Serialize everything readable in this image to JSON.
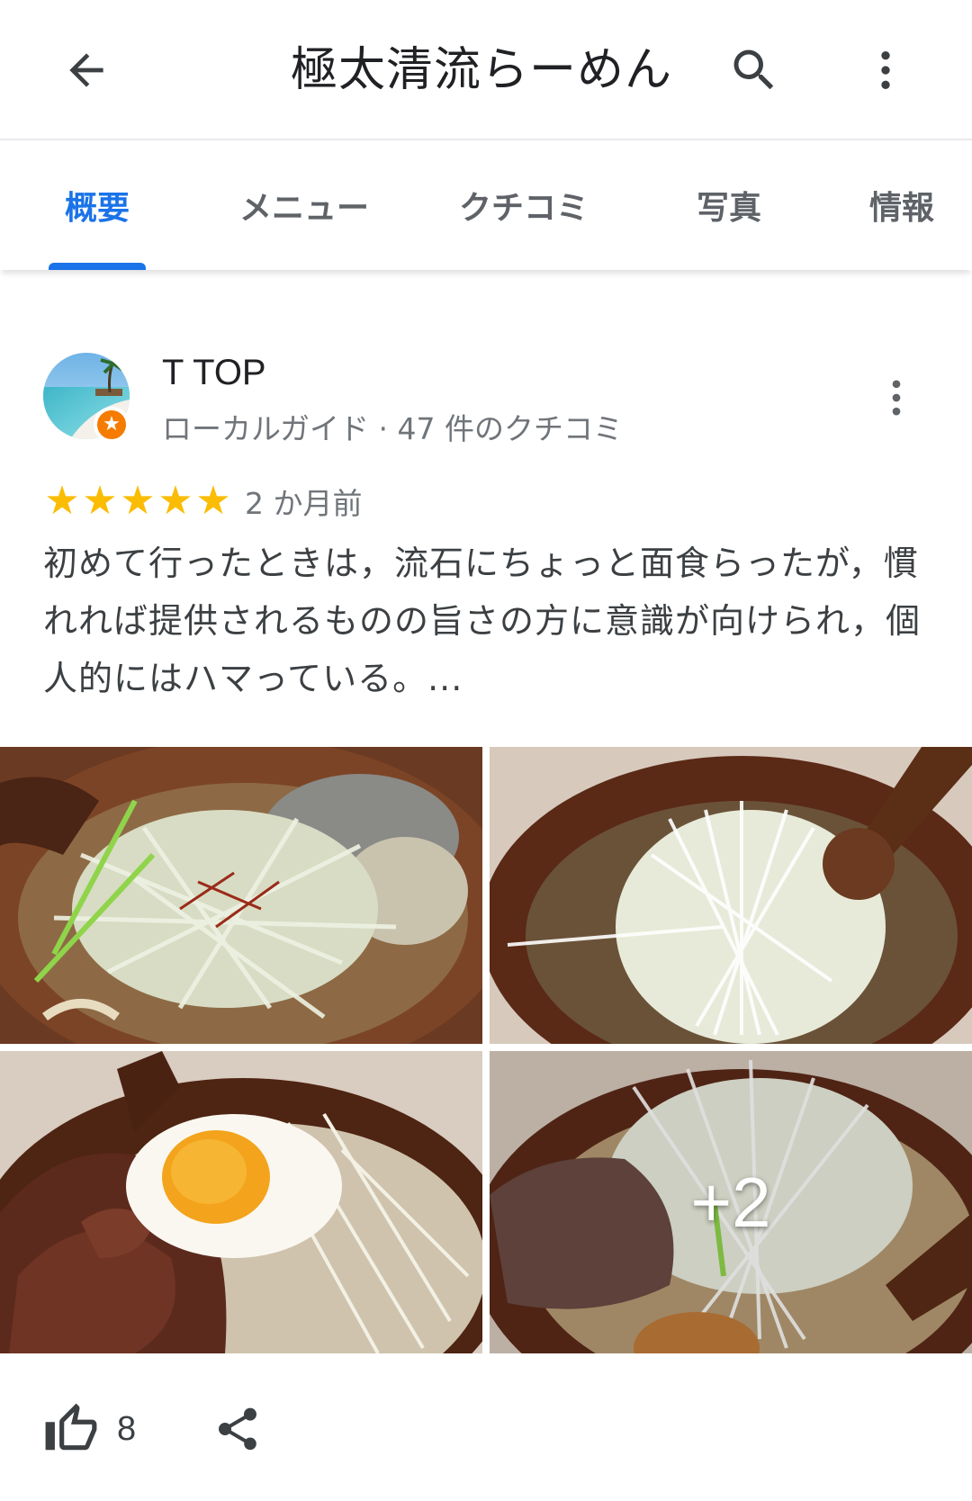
{
  "appbar": {
    "title": "極太清流らーめん",
    "back_icon": "arrow-back-icon",
    "search_icon": "search-icon",
    "more_icon": "more-vert-icon"
  },
  "tabs": [
    {
      "label": "概要",
      "active": true
    },
    {
      "label": "メニュー",
      "active": false
    },
    {
      "label": "クチコミ",
      "active": false
    },
    {
      "label": "写真",
      "active": false
    },
    {
      "label": "情報",
      "active": false
    }
  ],
  "review": {
    "reviewer_name": "T TOP",
    "reviewer_meta": "ローカルガイド · 47 件のクチコミ",
    "rating": 5,
    "max_rating": 5,
    "date": "2 か月前",
    "text": "初めて行ったときは，流石にちょっと面食らったが，慣れれば提供されるものの旨さの方に意識が向けられ，個人的にはハマっている。...",
    "photos_extra_count": "+2",
    "likes": "8"
  },
  "colors": {
    "accent": "#1a73e8",
    "star": "#fbbc04",
    "guide_badge": "#f57c00",
    "text_primary": "#202124",
    "text_secondary": "#70757a"
  }
}
